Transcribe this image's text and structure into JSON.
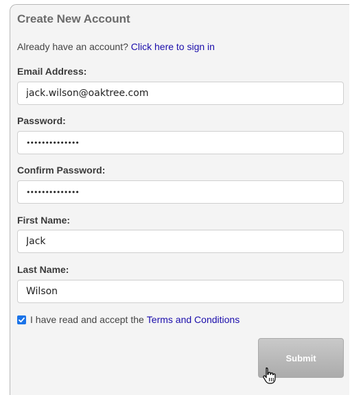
{
  "form": {
    "title": "Create New Account",
    "signin_prompt": "Already have an account?",
    "signin_link": "Click here to sign in",
    "email": {
      "label": "Email Address:",
      "value": "jack.wilson@oaktree.com"
    },
    "password": {
      "label": "Password:",
      "value": "••••••••••••••"
    },
    "confirm_password": {
      "label": "Confirm Password:",
      "value": "••••••••••••••"
    },
    "first_name": {
      "label": "First Name:",
      "value": "Jack"
    },
    "last_name": {
      "label": "Last Name:",
      "value": "Wilson"
    },
    "terms": {
      "checked": true,
      "text": "I have read and accept the",
      "link": "Terms and Conditions"
    },
    "submit_label": "Submit"
  },
  "colors": {
    "link": "#1a0dab",
    "checkbox": "#1a73e8",
    "submit_bg": "#b5b5b5"
  },
  "icons": {
    "cursor": "hand-pointer-cursor-icon",
    "checkmark": "checkmark-icon"
  }
}
